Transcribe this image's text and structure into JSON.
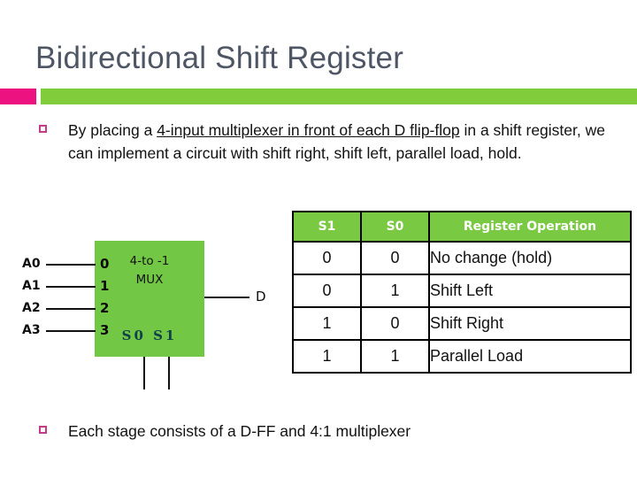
{
  "slide": {
    "title": "Bidirectional Shift Register",
    "accent_pink": "#ec127f",
    "accent_green": "#80cc3a",
    "title_color": "#4e5665"
  },
  "bullets": [
    {
      "marker": "square-outline-bullet",
      "text_before": "By placing a ",
      "text_underlined": "4-input multiplexer in front of each D flip-flop",
      "text_after": " in a shift register, we can implement a circuit with shift right, shift left, parallel load, hold."
    },
    {
      "marker": "square-outline-bullet",
      "text": "Each stage consists of a D-FF and 4:1 multiplexer"
    }
  ],
  "diagram": {
    "block_color": "#72c845",
    "title_line1": "4-to -1",
    "title_line2": "MUX",
    "inputs": [
      {
        "label": "A0",
        "port": "0"
      },
      {
        "label": "A1",
        "port": "1"
      },
      {
        "label": "A2",
        "port": "2"
      },
      {
        "label": "A3",
        "port": "3"
      }
    ],
    "select_labels": "S0  S1",
    "output_label": "D"
  },
  "truth_table": {
    "header_color": "#79c943",
    "headers": [
      "S1",
      "S0",
      "Register Operation"
    ],
    "rows": [
      {
        "s1": "0",
        "s0": "0",
        "operation": "No change (hold)"
      },
      {
        "s1": "0",
        "s0": "1",
        "operation": "Shift Left"
      },
      {
        "s1": "1",
        "s0": "0",
        "operation": "Shift Right"
      },
      {
        "s1": "1",
        "s0": "1",
        "operation": "Parallel Load"
      }
    ]
  }
}
